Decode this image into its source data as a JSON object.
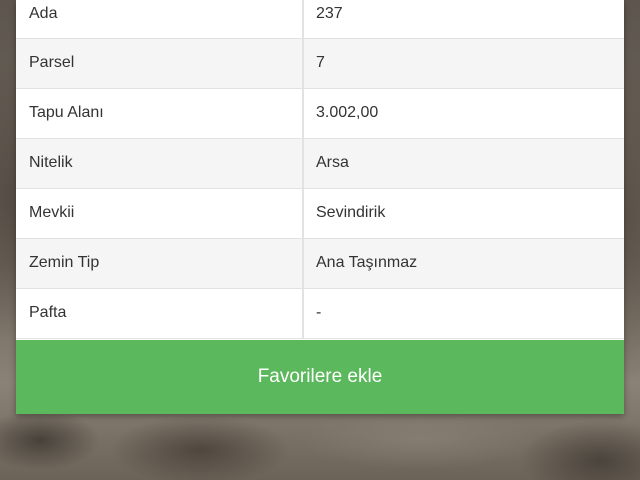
{
  "parcel_info": {
    "rows": [
      {
        "label": "Ada",
        "value": "237"
      },
      {
        "label": "Parsel",
        "value": "7"
      },
      {
        "label": "Tapu Alanı",
        "value": "3.002,00"
      },
      {
        "label": "Nitelik",
        "value": "Arsa"
      },
      {
        "label": "Mevkii",
        "value": "Sevindirik"
      },
      {
        "label": "Zemin Tip",
        "value": "Ana Taşınmaz"
      },
      {
        "label": "Pafta",
        "value": "-"
      }
    ]
  },
  "actions": {
    "favorite_label": "Favorilere ekle"
  },
  "colors": {
    "button_green": "#5cb85c",
    "stripe_gray": "#f5f5f5",
    "border_gray": "#e2e2e2"
  }
}
